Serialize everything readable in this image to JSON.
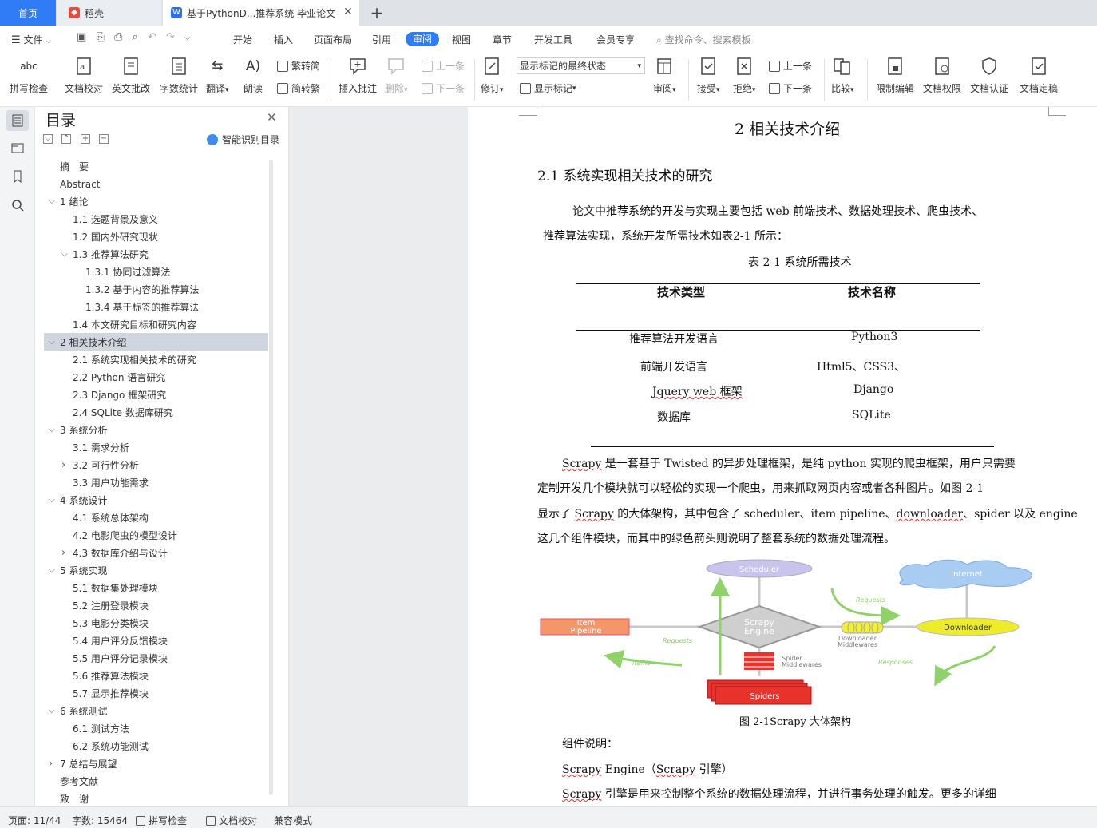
{
  "tabs": {
    "home": "首页",
    "shell": "稻壳",
    "doc": "基于PythonD...推荐系统 毕业论文",
    "add": "+"
  },
  "menubar": {
    "file": "文件",
    "items": [
      "开始",
      "插入",
      "页面布局",
      "引用",
      "审阅",
      "视图",
      "章节",
      "开发工具",
      "会员专享"
    ],
    "search": "查找命令、搜索模板"
  },
  "ribbon": {
    "spell": "拼写检查",
    "proof": "文档校对",
    "eng": "英文批改",
    "count": "字数统计",
    "translate": "翻译",
    "read": "朗读",
    "trad": "繁转简",
    "simp": "简转繁",
    "insert_comment": "插入批注",
    "delete": "删除",
    "prev": "上一条",
    "next": "下一条",
    "revise": "修订",
    "markup_state": "显示标记的最终状态",
    "show_markup": "显示标记",
    "review": "审阅",
    "accept": "接受",
    "reject": "拒绝",
    "prev2": "上一条",
    "next2": "下一条",
    "compare": "比较",
    "restrict": "限制编辑",
    "rights": "文档权限",
    "cert": "文档认证",
    "final": "文档定稿"
  },
  "toc": {
    "title": "目录",
    "smart": "智能识别目录",
    "items": [
      "摘　要",
      "Abstract",
      "1 绪论",
      "1.1 选题背景及意义",
      "1.2 国内外研究现状",
      "1.3 推荐算法研究",
      "1.3.1 协同过滤算法",
      "1.3.2 基于内容的推荐算法",
      "1.3.4 基于标签的推荐算法",
      "1.4 本文研究目标和研究内容",
      "2 相关技术介绍",
      "2.1 系统实现相关技术的研究",
      "2.2 Python 语言研究",
      "2.3 Django 框架研究",
      "2.4 SQLite 数据库研究",
      "3 系统分析",
      "3.1 需求分析",
      "3.2 可行性分析",
      "3.3 用户功能需求",
      "4 系统设计",
      "4.1 系统总体架构",
      "4.2 电影爬虫的模型设计",
      "4.3 数据库介绍与设计",
      "5 系统实现",
      "5.1 数据集处理模块",
      "5.2 注册登录模块",
      "5.3 电影分类模块",
      "5.4 用户评分反馈模块",
      "5.5 用户评分记录模块",
      "5.6 推荐算法模块",
      "5.7 显示推荐模块",
      "6 系统测试",
      "6.1 测试方法",
      "6.2 系统功能测试",
      "7 总结与展望",
      "参考文献",
      "致　谢"
    ]
  },
  "doc": {
    "h1": "2 相关技术介绍",
    "h2": "2.1 系统实现相关技术的研究",
    "p1a": "论文中推荐系统的开发与实现主要包括 web 前端技术、数据处理技术、爬虫技术、",
    "p1b": "推荐算法实现，系统开发所需技术如表2-1 所示：",
    "table_caption": "表  2-1 系统所需技术",
    "th1": "技术类型",
    "th2": "技术名称",
    "rows": [
      [
        "推荐算法开发语言",
        "Python3"
      ],
      [
        "前端开发语言",
        "Html5、CSS3、"
      ],
      [
        "Jquery web  框架",
        "Django"
      ],
      [
        "数据库",
        "SQLite"
      ]
    ],
    "p2a_word": "Scrapy",
    "p2a": " 是一套基于 Twisted 的异步处理框架，是纯 python 实现的爬虫框架，用户只需要",
    "p2b": "定制开发几个模块就可以轻松的实现一个爬虫，用来抓取网页内容或者各种图片。如图 2-1",
    "p2c1": "显示了 ",
    "p2c_word": "Scrapy",
    "p2c2": " 的大体架构，其中包含了 scheduler、item pipeline、",
    "p2c_word2": "downloader",
    "p2c3": "、spider 以及 engine",
    "p2d": "这几个组件模块，而其中的绿色箭头则说明了整套系统的数据处理流程。",
    "fig_caption": "图 2-1Scrapy 大体架构",
    "comp": "组件说明：",
    "engine_title_word": "Scrapy",
    "engine_title": " Engine（",
    "engine_title_word2": "Scrapy",
    "engine_title_end": " 引擎）",
    "engine_word": "Scrapy",
    "engine_desc": " 引擎是用来控制整个系统的数据处理流程，并进行事务处理的触发。更多的详细"
  },
  "diagram": {
    "scheduler": "Scheduler",
    "internet": "Internet",
    "engine1": "Scrapy",
    "engine2": "Engine",
    "item1": "Item",
    "item2": "Pipeline",
    "downloader": "Downloader",
    "dm1": "Downloader",
    "dm2": "Middlewares",
    "sm1": "Spider",
    "sm2": "Middlewares",
    "spiders": "Spiders",
    "requests1": "Requests",
    "requests2": "Requests",
    "items": "Items",
    "responses": "Responses"
  },
  "status": {
    "page": "页面: 11/44",
    "words": "字数: 15464",
    "spell": "拼写检查",
    "proof": "文档校对",
    "compat": "兼容模式"
  }
}
